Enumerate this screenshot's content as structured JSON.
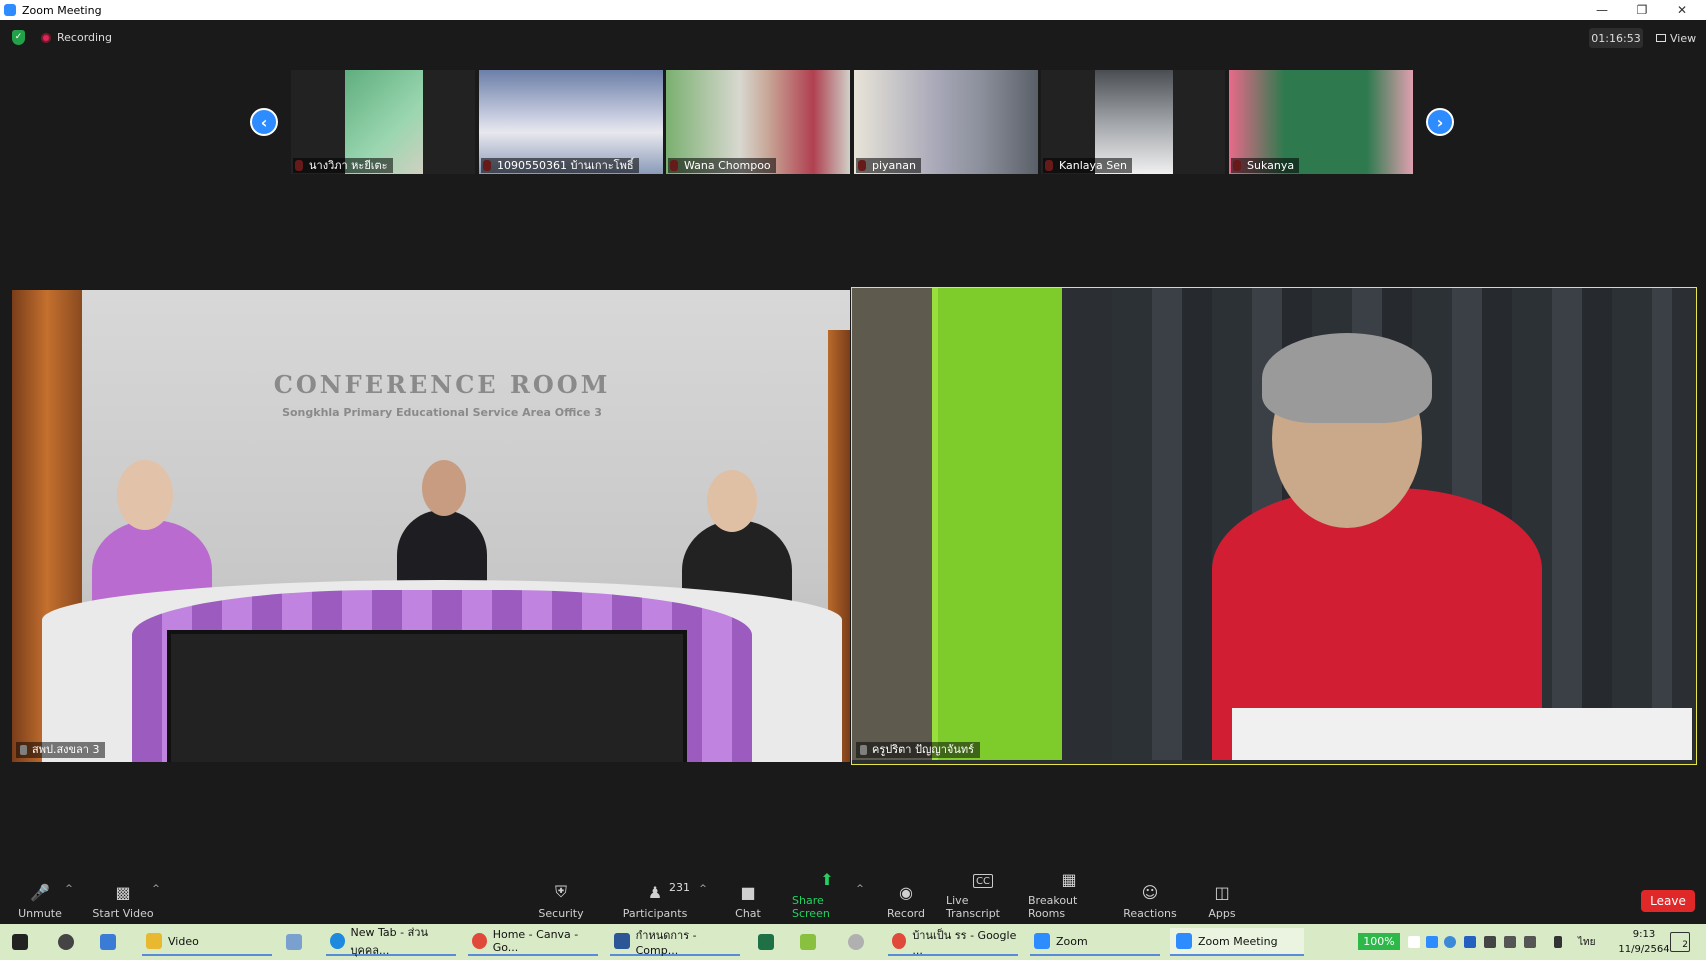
{
  "window": {
    "title": "Zoom Meeting"
  },
  "topbar": {
    "recording_label": "Recording",
    "timer": "01:16:53",
    "view_label": "View"
  },
  "thumbnails": [
    {
      "name": "นางวิภา หะยีเตะ"
    },
    {
      "name": "1090550361 บ้านเกาะโพธิ์"
    },
    {
      "name": "Wana Chompoo"
    },
    {
      "name": "piyanan"
    },
    {
      "name": "Kanlaya Sen"
    },
    {
      "name": "Sukanya"
    }
  ],
  "conference_tile": {
    "name": "สพป.สงขลา 3",
    "sign": "CONFERENCE ROOM",
    "sign_sub": "Songkhla Primary Educational Service Area Office 3"
  },
  "speaker_tile": {
    "name": "ครูปริตา ปัญญาจันทร์"
  },
  "toolbar": {
    "unmute": "Unmute",
    "start_video": "Start Video",
    "security": "Security",
    "participants": "Participants",
    "participants_count": "231",
    "chat": "Chat",
    "share_screen": "Share Screen",
    "record": "Record",
    "live_transcript": "Live Transcript",
    "breakout_rooms": "Breakout Rooms",
    "reactions": "Reactions",
    "apps": "Apps",
    "leave": "Leave"
  },
  "taskbar": {
    "items": [
      {
        "label": "Video"
      },
      {
        "label": "New Tab - ส่วนบุคคล..."
      },
      {
        "label": "Home - Canva - Go..."
      },
      {
        "label": "กำหนดการ - Comp..."
      },
      {
        "label": "บ้านเป็น รร - Google ..."
      },
      {
        "label": "Zoom"
      },
      {
        "label": "Zoom Meeting"
      }
    ],
    "battery": "100%",
    "lang": "ไทย",
    "time": "9:13",
    "date": "11/9/2564",
    "notifications": "2"
  },
  "colors": {
    "accent": "#2d8cff",
    "active_speaker": "#e6e64a",
    "leave": "#e02828",
    "share": "#23d160"
  }
}
